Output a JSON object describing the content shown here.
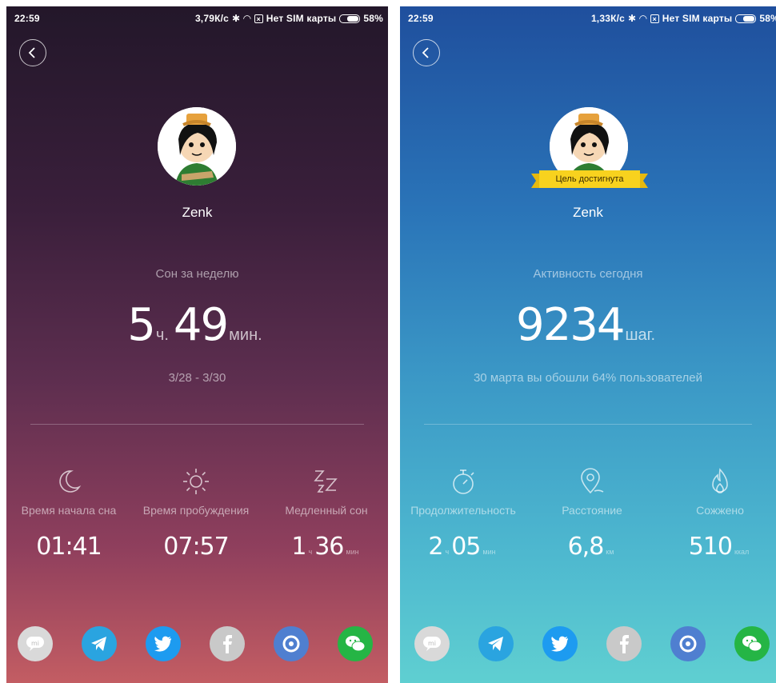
{
  "panels": {
    "sleep": {
      "status": {
        "time": "22:59",
        "speed": "3,79К/с",
        "sim": "Нет SIM карты",
        "battery": "58%"
      },
      "username": "Zenk",
      "caption": "Сон за неделю",
      "hours": "5",
      "hours_unit": "ч.",
      "minutes": "49",
      "minutes_unit": "мин.",
      "date_range": "3/28 - 3/30",
      "stats": [
        {
          "label": "Время начала сна",
          "value": "01:41"
        },
        {
          "label": "Время пробуждения",
          "value": "07:57"
        },
        {
          "label": "Медленный сон",
          "value_h": "1",
          "unit_h": "ч",
          "value_m": "36",
          "unit_m": "мин"
        }
      ],
      "icons": [
        "moon-icon",
        "sun-icon",
        "zzz-icon"
      ]
    },
    "activity": {
      "status": {
        "time": "22:59",
        "speed": "1,33К/с",
        "sim": "Нет SIM карты",
        "battery": "58%"
      },
      "badge": "Цель достигнута",
      "username": "Zenk",
      "caption": "Активность сегодня",
      "steps": "9234",
      "steps_unit": "шаг.",
      "note": "30 марта вы обошли 64% пользователей",
      "stats": [
        {
          "label": "Продолжительность",
          "value_h": "2",
          "unit_h": "ч",
          "value_m": "05",
          "unit_m": "мин"
        },
        {
          "label": "Расстояние",
          "value": "6,8",
          "unit": "км"
        },
        {
          "label": "Сожжено",
          "value": "510",
          "unit": "ккал"
        }
      ],
      "icons": [
        "stopwatch-icon",
        "location-pin-icon",
        "flame-icon"
      ]
    }
  },
  "share_buttons": [
    {
      "name": "mi-talk-icon",
      "color": "#d9d9d9"
    },
    {
      "name": "telegram-icon",
      "color": "#2aa4e0"
    },
    {
      "name": "twitter-icon",
      "color": "#1d9bf0"
    },
    {
      "name": "facebook-icon",
      "color": "#c9c9c9"
    },
    {
      "name": "camera-shutter-icon",
      "color": "#4f7fd0"
    },
    {
      "name": "wechat-icon",
      "color": "#25b545"
    }
  ]
}
